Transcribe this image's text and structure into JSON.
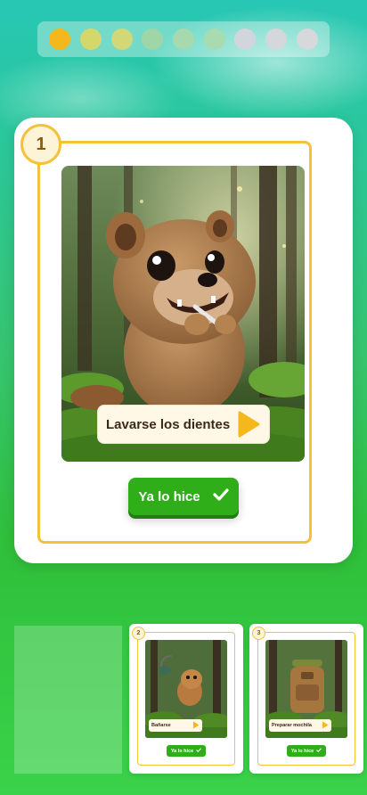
{
  "progress": {
    "dot_colors": [
      "#f4b81c",
      "#d4d86a",
      "#d2d878",
      "#9fd6a8",
      "#a6d9ae",
      "#a9dbb0",
      "#d2d6dc",
      "#d4d7dc",
      "#d6d8dc"
    ],
    "current_step": 1,
    "total_steps": 9
  },
  "main_task": {
    "step_number": "1",
    "label": "Lavarse los dientes",
    "done_button": "Ya lo hice",
    "image_icon": "quokka-brushing-teeth-image"
  },
  "upcoming_tasks": [
    {
      "step_number": "2",
      "label": "Bañarse",
      "done_button": "Ya lo hice",
      "image_icon": "quokka-shower-image"
    },
    {
      "step_number": "3",
      "label": "Preparar mochila",
      "done_button": "Ya lo hice",
      "image_icon": "backpack-forest-image"
    }
  ],
  "colors": {
    "accent_yellow": "#f4c13a",
    "button_green": "#2fae1a"
  }
}
